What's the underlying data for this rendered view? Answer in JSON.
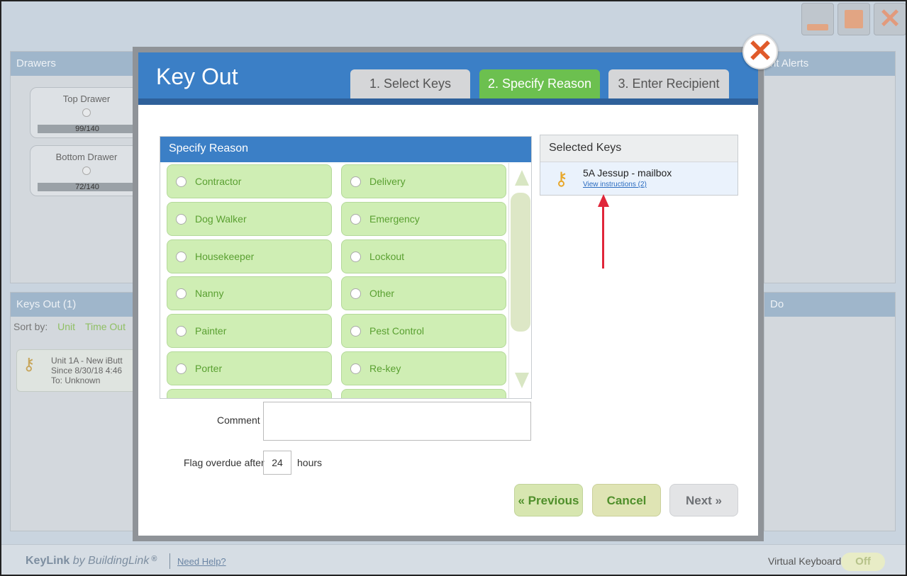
{
  "background": {
    "drawers": {
      "title": "Drawers",
      "items": [
        {
          "name": "Top Drawer",
          "count": "99/140"
        },
        {
          "name": "Bottom Drawer",
          "count": "72/140"
        }
      ]
    },
    "alerts_title": "nt Alerts",
    "keys_out": {
      "title": "Keys Out (1)",
      "sort_label": "Sort by:",
      "sort_unit": "Unit",
      "sort_time": "Time Out",
      "item": {
        "line1": "Unit  1A - New iButt",
        "line2": "Since   8/30/18 4:46",
        "line3": "To:  Unknown"
      }
    },
    "todo_title": "Do"
  },
  "footer": {
    "brand_key": "KeyLink",
    "brand_by": " by ",
    "brand_bl": "BuildingLink",
    "brand_reg": " ®",
    "help": "Need Help?",
    "vk_label": "Virtual Keyboard",
    "vk_value": "Off"
  },
  "modal": {
    "title": "Key Out",
    "tabs": [
      "1. Select Keys",
      "2. Specify Reason",
      "3. Enter Recipient"
    ],
    "reason": {
      "title": "Specify Reason",
      "options_left": [
        "Contractor",
        "Dog Walker",
        "Housekeeper",
        "Nanny",
        "Painter",
        "Porter"
      ],
      "options_right": [
        "Delivery",
        "Emergency",
        "Lockout",
        "Other",
        "Pest Control",
        "Re-key"
      ]
    },
    "comment_label": "Comment",
    "comment_value": "",
    "flag_label": "Flag overdue after",
    "flag_value": "24",
    "hours_label": "hours",
    "selected": {
      "title": "Selected Keys",
      "key_name": "5A Jessup - mailbox",
      "link": "View instructions (2)"
    },
    "buttons": {
      "previous": "« Previous",
      "cancel": "Cancel",
      "next": "Next »"
    }
  }
}
